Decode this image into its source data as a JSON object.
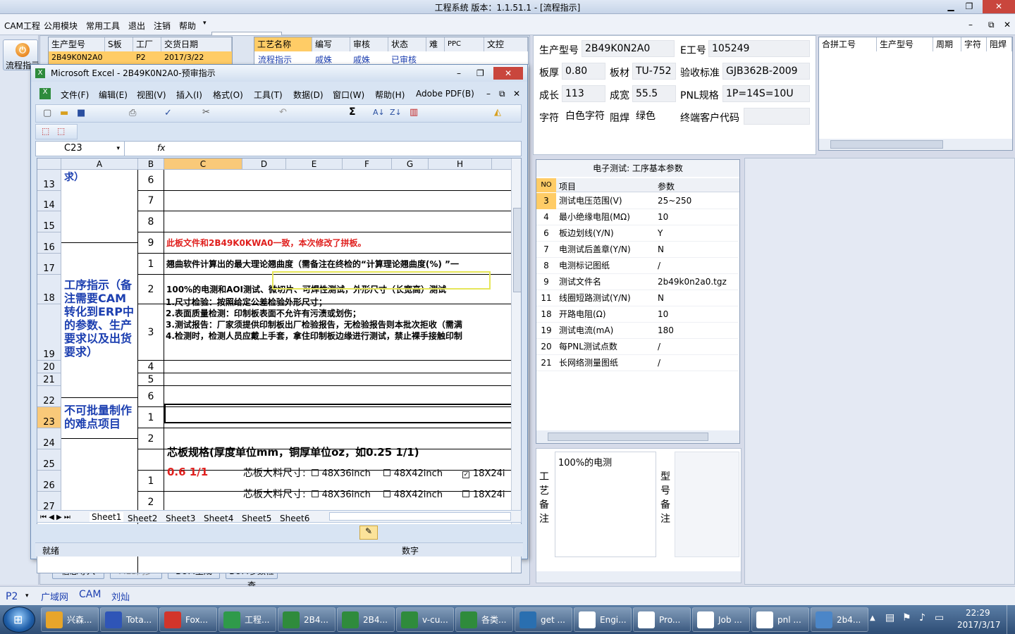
{
  "window": {
    "title": "工程系统   版本：1.1.51.1 - [流程指示]"
  },
  "menu": [
    "CAM工程",
    "公用模块",
    "常用工具",
    "退出",
    "注销",
    "帮助"
  ],
  "left": {
    "flow_label": "流程指示"
  },
  "order_grid": {
    "headers": [
      "生产型号",
      "S板",
      "工厂",
      "交货日期"
    ],
    "row": [
      "2B49K0N2A0",
      "",
      "P2",
      "2017/3/22"
    ]
  },
  "process_grid": {
    "headers": [
      "工艺名称",
      "编写",
      "审核",
      "状态",
      "难",
      "PPC",
      "文控"
    ],
    "row": [
      "流程指示",
      "戚姝",
      "戚姝",
      "已审核"
    ]
  },
  "info": {
    "model_label": "生产型号",
    "model": "2B49K0N2A0",
    "eno_label": "E工号",
    "eno": "105249",
    "thick_label": "板厚",
    "thick": "0.80",
    "material_label": "板材",
    "material": "TU-752",
    "std_label": "验收标准",
    "std": "GJB362B-2009",
    "grow_label": "成长",
    "grow": "113",
    "width_label": "成宽",
    "width": "55.5",
    "pnl_label": "PNL规格",
    "pnl": "1P=14S=10U",
    "char_label": "字符",
    "char": "白色字符",
    "mask_label": "阻焊",
    "mask": "绿色",
    "cust_label": "终端客户代码",
    "cust": ""
  },
  "merge_grid": {
    "headers": [
      "合拼工号",
      "生产型号",
      "周期",
      "字符",
      "阻焊"
    ]
  },
  "et": {
    "title": "电子测试: 工序基本参数",
    "headers": [
      "NO",
      "项目",
      "参数"
    ],
    "rows": [
      [
        "3",
        "测试电压范围(V)",
        "25~250"
      ],
      [
        "4",
        "最小绝缘电阻(MΩ)",
        "10"
      ],
      [
        "6",
        "板边划线(Y/N)",
        "Y"
      ],
      [
        "7",
        "电测试后盖章(Y/N)",
        "N"
      ],
      [
        "8",
        "电测标记图纸",
        "/"
      ],
      [
        "9",
        "测试文件名",
        "2b49k0n2a0.tgz"
      ],
      [
        "11",
        "线圈短路测试(Y/N)",
        "N"
      ],
      [
        "18",
        "开路电阻(Ω)",
        "10"
      ],
      [
        "19",
        "测试电流(mA)",
        "180"
      ],
      [
        "20",
        "每PNL测试点数",
        "/"
      ],
      [
        "21",
        "长网络测量图纸",
        "/"
      ]
    ]
  },
  "remarks": {
    "process_label": "工艺备注",
    "process_text": "100%的电测",
    "model_label": "型号备注"
  },
  "bottom_buttons": [
    "信息导入",
    "MES同步",
    "BOM生成",
    "BOM参数检查"
  ],
  "status": {
    "plant": "P2",
    "items": [
      "广域网",
      "CAM",
      "刘灿"
    ]
  },
  "excel": {
    "title": "Microsoft Excel - 2B49K0N2A0-预审指示",
    "menu": [
      "文件(F)",
      "编辑(E)",
      "视图(V)",
      "插入(I)",
      "格式(O)",
      "工具(T)",
      "数据(D)",
      "窗口(W)",
      "帮助(H)",
      "Adobe PDF(B)"
    ],
    "namebox": "C23",
    "fx": "fx",
    "cols": [
      "A",
      "B",
      "C",
      "D",
      "E",
      "F",
      "G",
      "H"
    ],
    "row13_fragment": "求）",
    "rows": [
      {
        "n": "13",
        "b": "6",
        "c": ""
      },
      {
        "n": "14",
        "b": "7",
        "c": ""
      },
      {
        "n": "15",
        "b": "8",
        "c": ""
      },
      {
        "n": "16",
        "b": "9",
        "c": "此板文件和2B49K0KWA0一致，本次修改了拼板。"
      },
      {
        "n": "17",
        "b": "1",
        "c": "翘曲软件计算出的最大理论翘曲度（需备注在终检的“计算理论翘曲度(%)  ”一"
      },
      {
        "n": "18",
        "b": "2",
        "c": "100%的电测和AOI测试、微切片、可焊性测试，外形尺寸（长宽高）测试"
      },
      {
        "n": "19",
        "b": "3",
        "c": ""
      },
      {
        "n": "20",
        "b": "4",
        "c": ""
      },
      {
        "n": "21",
        "b": "5",
        "c": ""
      },
      {
        "n": "22",
        "b": "6",
        "c": ""
      },
      {
        "n": "23",
        "b": "1",
        "c": ""
      },
      {
        "n": "24",
        "b": "2",
        "c": ""
      },
      {
        "n": "25",
        "b": "",
        "c": ""
      },
      {
        "n": "26",
        "b": "1",
        "c": ""
      },
      {
        "n": "27",
        "b": "2",
        "c": ""
      }
    ],
    "row19_lines": [
      "1.尺寸检验：按照给定公差检验外形尺寸；",
      "2.表面质量检测：印制板表面不允许有污渍或划伤；",
      "3.测试报告：厂家须提供印制板出厂检验报告，无检验报告则本批次拒收（需满",
      "4.检测时，检测人员应戴上手套，拿住印制板边缘进行测试，禁止裸手接触印制"
    ],
    "group_a1": "工序指示（备注需要CAM转化到ERP中的参数、生产要求以及出货要求）",
    "group_a2": "不可批量制作的难点项目",
    "core_header": "芯板规格(厚度单位mm，铜厚单位oz，如0.25 1/1)",
    "core_value": "0.6 1/1",
    "core_size_label": "芯板大料尺寸:",
    "size_opts": [
      "48X36inch",
      "48X42inch",
      "18X24i"
    ],
    "sheets": [
      "Sheet1",
      "Sheet2",
      "Sheet3",
      "Sheet4",
      "Sheet5",
      "Sheet6"
    ],
    "status_left": "就绪",
    "status_num": "数字"
  },
  "taskbar": {
    "items": [
      "兴森...",
      "Tota...",
      "Fox...",
      "工程...",
      "2B4...",
      "2B4...",
      "v-cu...",
      "各类...",
      "get ...",
      "Engi...",
      "Pro...",
      "Job ...",
      "pnl ...",
      "2b4..."
    ],
    "time": "22:29",
    "date": "2017/3/17"
  }
}
